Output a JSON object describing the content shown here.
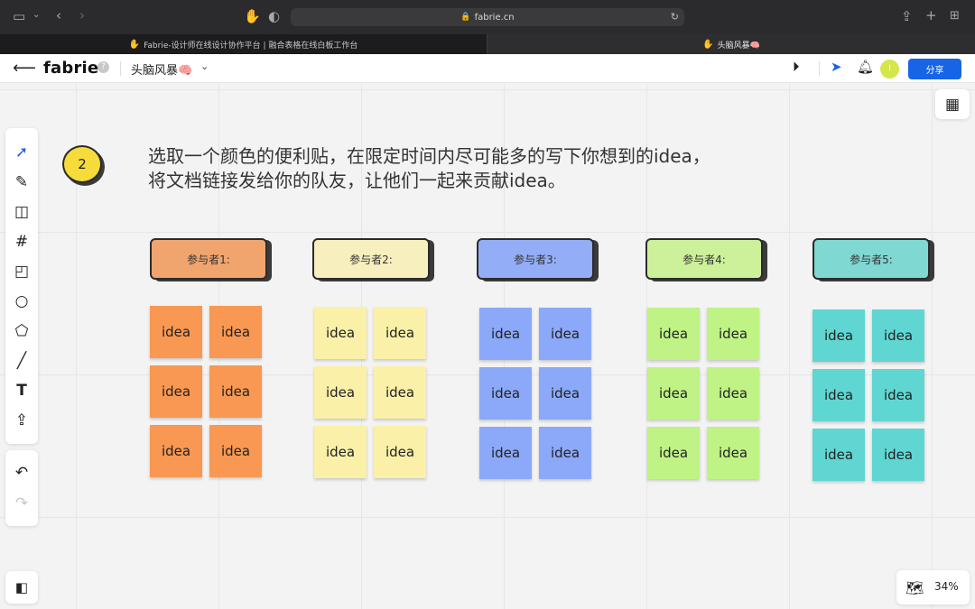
{
  "browser": {
    "url": "fabrie.cn",
    "tabs": [
      {
        "label": "Fabrie-设计师在线设计协作平台 | 融合表格在线白板工作台"
      },
      {
        "label": "头脑风暴🧠"
      }
    ]
  },
  "header": {
    "brand": "fabrie",
    "help": "?",
    "doc_title": "头脑风暴🧠",
    "avatar_initial": "I",
    "share_label": "分享"
  },
  "canvas": {
    "step_number": "2",
    "instruction_line1": "选取一个颜色的便利贴，在限定时间内尽可能多的写下你想到的idea，",
    "instruction_line2": "将文档链接发给你的队友，让他们一起来贡献idea。",
    "zoom": "34%",
    "participants": [
      {
        "label": "参与者1:",
        "color": "#f0a56e",
        "sticky_color": "#f99852",
        "notes": [
          "idea",
          "idea",
          "idea",
          "idea",
          "idea",
          "idea"
        ]
      },
      {
        "label": "参与者2:",
        "color": "#f8efbe",
        "sticky_color": "#faf0a8",
        "notes": [
          "idea",
          "idea",
          "idea",
          "idea",
          "idea",
          "idea"
        ]
      },
      {
        "label": "参与者3:",
        "color": "#93adf6",
        "sticky_color": "#8ba9f8",
        "notes": [
          "idea",
          "idea",
          "idea",
          "idea",
          "idea",
          "idea"
        ]
      },
      {
        "label": "参与者4:",
        "color": "#ccf19a",
        "sticky_color": "#bff385",
        "notes": [
          "idea",
          "idea",
          "idea",
          "idea",
          "idea",
          "idea"
        ]
      },
      {
        "label": "参与者5:",
        "color": "#7fd8d2",
        "sticky_color": "#5fd6d2",
        "notes": [
          "idea",
          "idea",
          "idea",
          "idea",
          "idea",
          "idea"
        ]
      }
    ]
  }
}
